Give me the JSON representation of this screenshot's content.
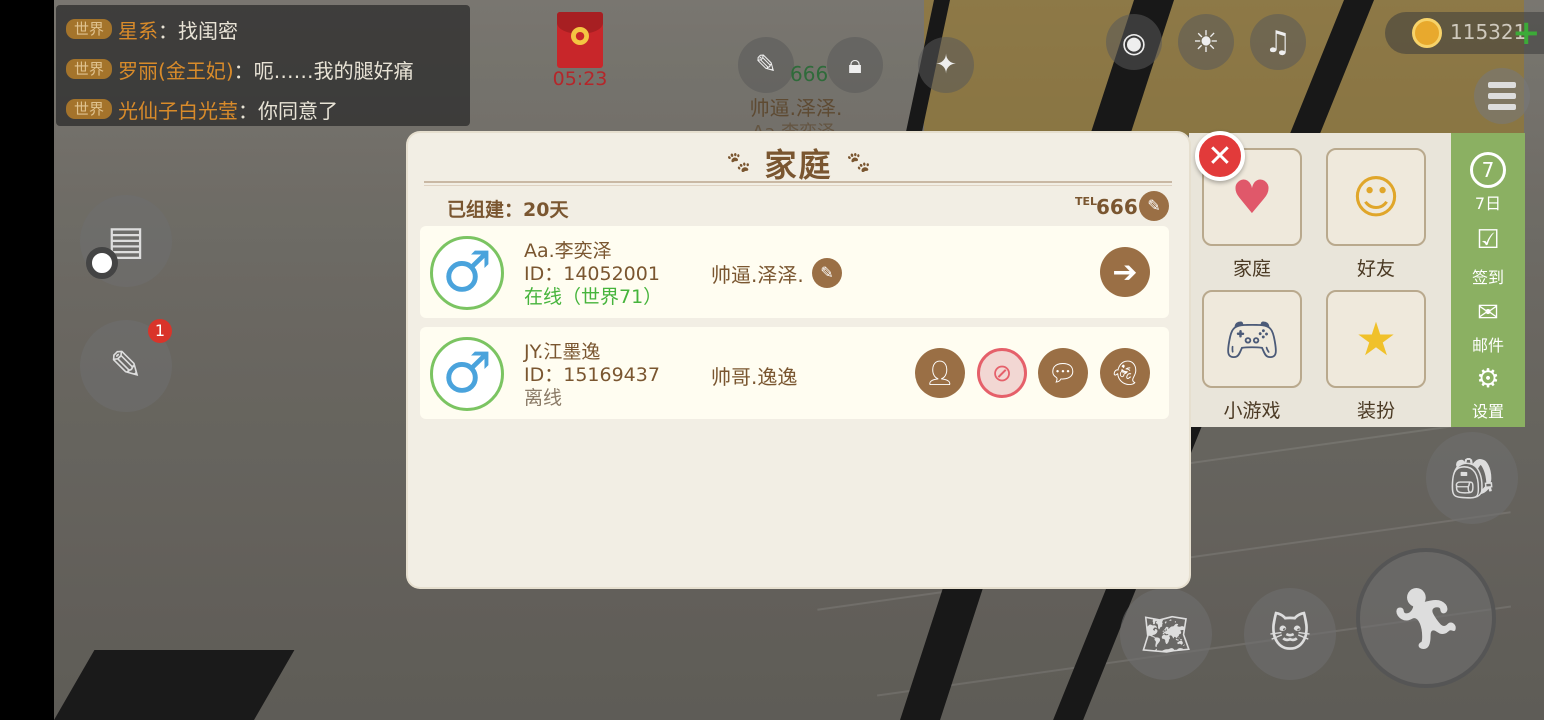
{
  "chat": {
    "lines": [
      {
        "tag": "世界",
        "name": "星系",
        "text": "：找闺密"
      },
      {
        "tag": "世界",
        "name": "罗丽(金王妃)",
        "text": "：呃……我的腿好痛"
      },
      {
        "tag": "世界",
        "name": "光仙子白光莹",
        "text": "：你同意了"
      }
    ]
  },
  "hud": {
    "redpacket_timer": "05:23",
    "house_number": "666",
    "house_owner": "帅逼.泽泽.",
    "house_owner_sub": "Aa.李奕泽",
    "coins": "115321",
    "coin_plus": "+"
  },
  "function_panel": {
    "tiles": [
      {
        "label": "家庭",
        "icon": "heart-icon"
      },
      {
        "label": "好友",
        "icon": "friends-icon"
      },
      {
        "label": "小游戏",
        "icon": "gamepad-icon"
      },
      {
        "label": "装扮",
        "icon": "wand-icon"
      }
    ],
    "side_items": [
      {
        "label": "7日",
        "icon": "seven-day-icon",
        "badge": "7"
      },
      {
        "label": "签到",
        "icon": "checkin-icon"
      },
      {
        "label": "邮件",
        "icon": "mail-icon"
      },
      {
        "label": "设置",
        "icon": "gear-icon"
      }
    ]
  },
  "side_buttons": {
    "notification_count": "1"
  },
  "family_modal": {
    "title": "家庭",
    "built_label": "已组建：20天",
    "tel_label": "TEL",
    "tel_number": "666",
    "members": [
      {
        "name": "Aa.李奕泽",
        "id": "ID：14052001",
        "status": "在线（世界71）",
        "status_color": "#46b43c",
        "nickname": "帅逼.泽泽.",
        "gender_symbol": "♂"
      },
      {
        "name": "JY.江墨逸",
        "id": "ID：15169437",
        "status": "离线",
        "status_color": "#8a7a66",
        "nickname": "帅哥.逸逸",
        "gender_symbol": "♂"
      }
    ]
  },
  "colors": {
    "accent_brown": "#9a6f45",
    "close_red": "#e23a3a",
    "online_green": "#46b43c"
  }
}
